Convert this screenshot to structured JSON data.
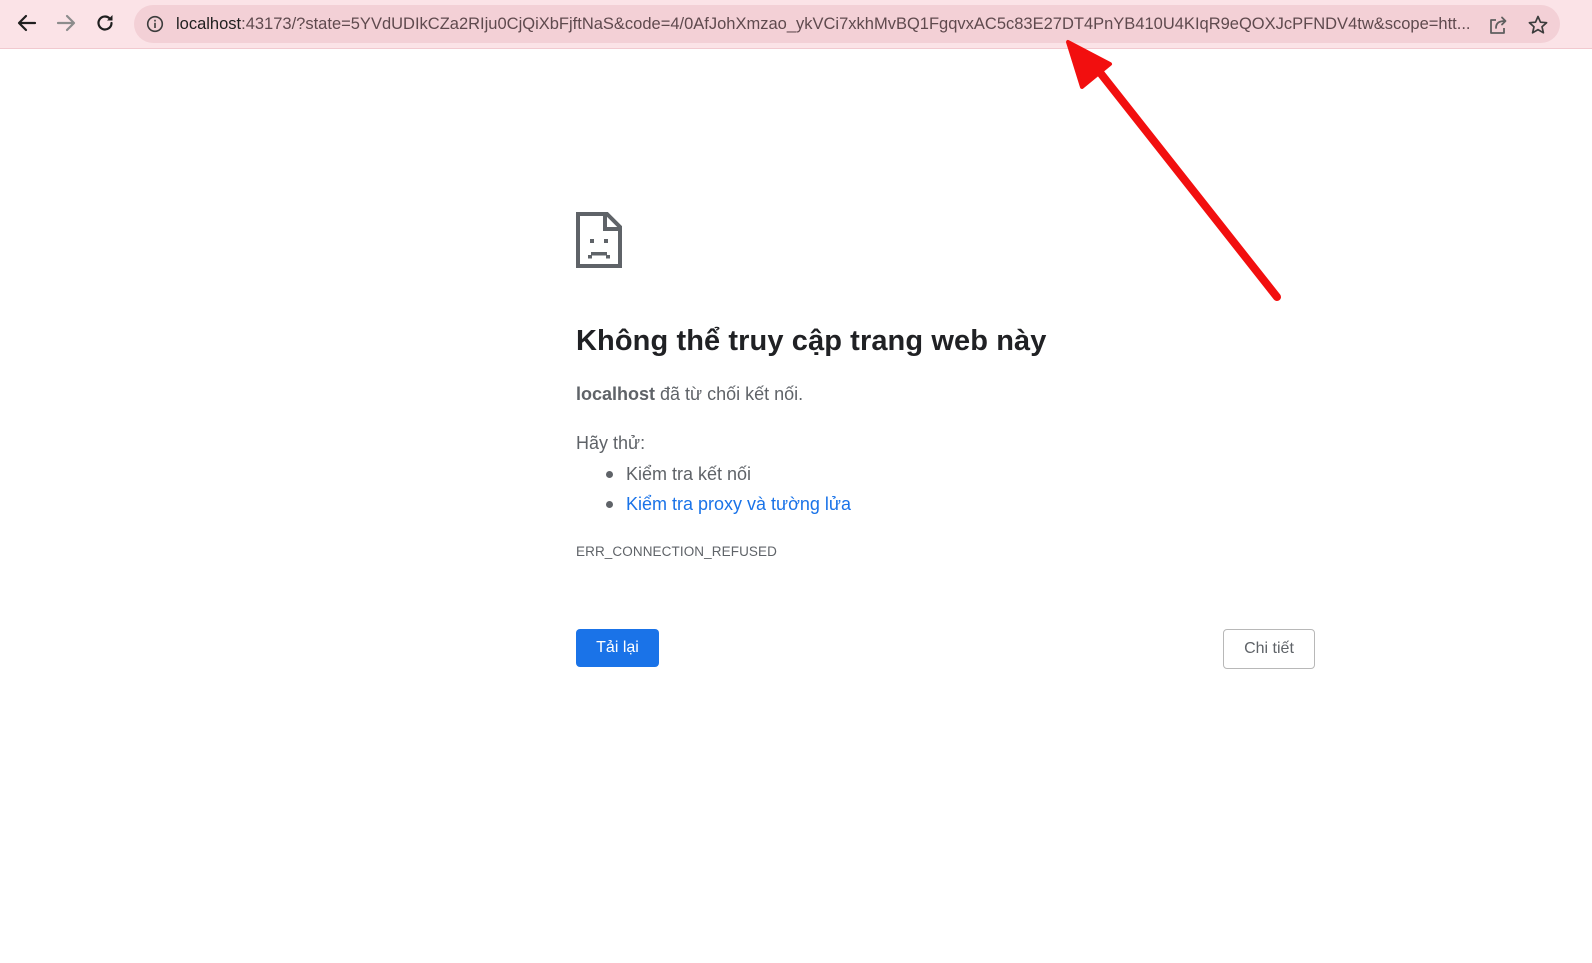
{
  "browser": {
    "url_host": "localhost",
    "url_rest": ":43173/?state=5YVdUDIkCZa2RIju0CjQiXbFjftNaS&code=4/0AfJohXmzao_ykVCi7xkhMvBQ1FgqvxAC5c83E27DT4PnYB410U4KIqR9eQOXJcPFNDV4tw&scope=htt...",
    "toolbar_color": "#fbe3e7",
    "icons": [
      "back-arrow-icon",
      "forward-arrow-icon",
      "reload-icon",
      "info-icon",
      "share-icon",
      "star-icon"
    ]
  },
  "error_page": {
    "icon": "sad-page-icon",
    "title": "Không thể truy cập trang web này",
    "message_host": "localhost",
    "message_text": " đã từ chối kết nối.",
    "try_label": "Hãy thử:",
    "suggestions": [
      {
        "label": "Kiểm tra kết nối"
      },
      {
        "label": "Kiểm tra proxy và tường lửa"
      }
    ],
    "error_code": "ERR_CONNECTION_REFUSED",
    "reload_button": "Tải lại",
    "details_button": "Chi tiết",
    "accent_color": "#1a73e8"
  },
  "annotation": {
    "type": "red-arrow-icon",
    "color": "#f20f0f"
  }
}
